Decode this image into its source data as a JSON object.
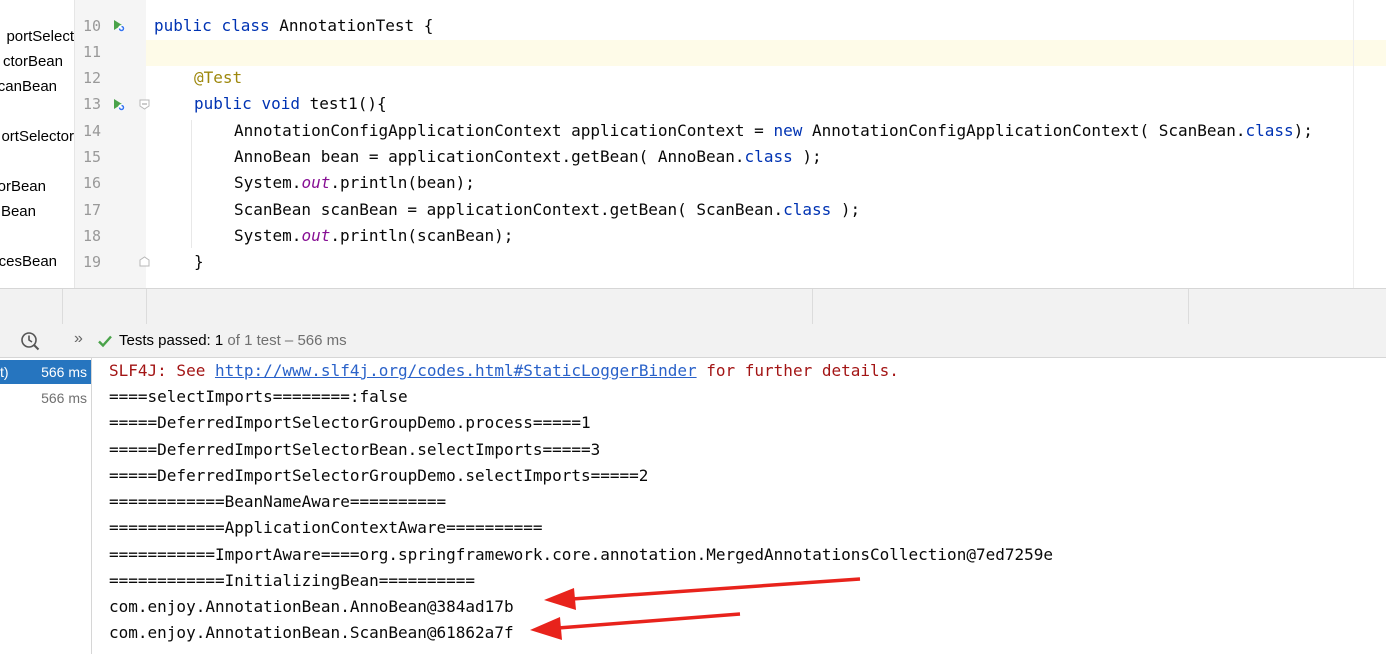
{
  "project_tree": {
    "items": [
      "portSelect",
      "ctorBean",
      "canBean",
      "ortSelector",
      "orBean",
      "Bean",
      "cesBean"
    ]
  },
  "editor": {
    "line_numbers": [
      "10",
      "11",
      "12",
      "13",
      "14",
      "15",
      "16",
      "17",
      "18",
      "19"
    ],
    "code": {
      "l10": {
        "kw1": "public",
        "kw2": "class",
        "rest": " AnnotationTest {"
      },
      "l12": {
        "annotation": "@Test"
      },
      "l13": {
        "kw1": "public",
        "kw2": "void",
        "rest": " test1(){"
      },
      "l14": {
        "a": "AnnotationConfigApplicationContext applicationContext = ",
        "kw": "new",
        "b": " AnnotationConfigApplicationContext( ScanBean.",
        "kw2": "class",
        "c": ");"
      },
      "l15": {
        "a": "AnnoBean bean = applicationContext.getBean( AnnoBean.",
        "kw": "class",
        "b": " );"
      },
      "l16": {
        "a": "System.",
        "field": "out",
        "b": ".println(bean);"
      },
      "l17": {
        "a": "ScanBean scanBean = applicationContext.getBean( ScanBean.",
        "kw": "class",
        "b": " );"
      },
      "l18": {
        "a": "System.",
        "field": "out",
        "b": ".println(scanBean);"
      },
      "l19": {
        "a": "}"
      }
    }
  },
  "run_toolbar": {
    "chevrons": "»",
    "status_prefix": "Tests passed: ",
    "passed_count": "1",
    "status_suffix": " of 1 test – 566 ms"
  },
  "test_tree": {
    "rows": [
      {
        "name": "t)",
        "time": "566 ms"
      },
      {
        "name": "",
        "time": "566 ms"
      }
    ]
  },
  "console": {
    "slf4j_prefix": "SLF4J: See ",
    "slf4j_link": "http://www.slf4j.org/codes.html#StaticLoggerBinder",
    "slf4j_suffix": " for further details.",
    "lines": [
      "====selectImports========:false",
      "=====DeferredImportSelectorGroupDemo.process=====1",
      "=====DeferredImportSelectorBean.selectImports=====3",
      "=====DeferredImportSelectorGroupDemo.selectImports=====2",
      "============BeanNameAware==========",
      "============ApplicationContextAware==========",
      "===========ImportAware====org.springframework.core.annotation.MergedAnnotationsCollection@7ed7259e",
      "============InitializingBean==========",
      "com.enjoy.AnnotationBean.AnnoBean@384ad17b",
      "com.enjoy.AnnotationBean.ScanBean@61862a7f"
    ]
  },
  "colors": {
    "keyword": "#0033b3",
    "annotation": "#9e880d",
    "error_text": "#a31515",
    "link": "#2a62c9",
    "selection": "#2675bf",
    "arrow": "#e8231c"
  }
}
